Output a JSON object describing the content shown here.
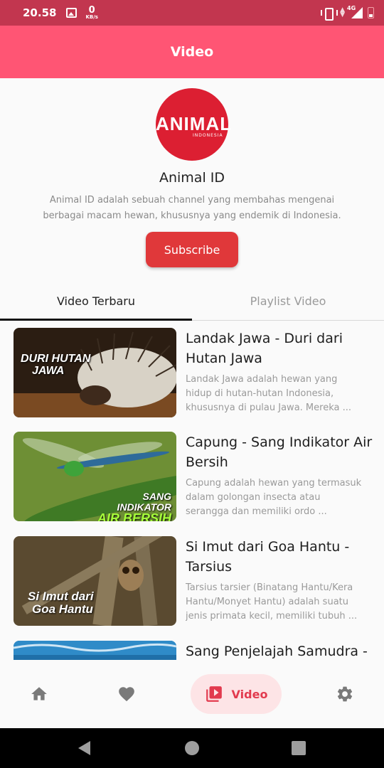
{
  "status_bar": {
    "time": "20.58",
    "speed_value": "0",
    "speed_unit": "KB/s",
    "network": "4G",
    "icons": [
      "gallery-icon",
      "vibrate-icon",
      "data-arrows-icon",
      "signal-icon",
      "battery-icon"
    ]
  },
  "app_bar": {
    "title": "Video"
  },
  "channel": {
    "logo_text": "ANIMAL",
    "logo_subtext": "INDONESIA",
    "name": "Animal ID",
    "description": "Animal ID adalah sebuah channel yang membahas mengenai berbagai macam hewan, khususnya yang endemik di Indonesia.",
    "subscribe_label": "Subscribe"
  },
  "tabs": [
    {
      "label": "Video Terbaru",
      "active": true
    },
    {
      "label": "Playlist Video",
      "active": false
    }
  ],
  "videos": [
    {
      "title": "Landak Jawa - Duri dari Hutan Jawa",
      "description": "Landak Jawa adalah hewan yang hidup di hutan-hutan Indonesia, khususnya di pulau Jawa. Mereka ...",
      "thumb_line1": "DURI HUTAN",
      "thumb_line2": "JAWA"
    },
    {
      "title": "Capung - Sang Indikator Air Bersih",
      "description": "Capung adalah hewan yang termasuk dalam golongan insecta atau serangga dan memiliki ordo ...",
      "thumb_line1": "SANG INDIKATOR",
      "thumb_line2": "AIR BERSIH"
    },
    {
      "title": "Si Imut dari Goa Hantu - Tarsius",
      "description": "Tarsius tarsier (Binatang Hantu/Kera Hantu/Monyet Hantu) adalah suatu jenis primata kecil, memiliki tubuh ...",
      "thumb_line1": "Si Imut dari",
      "thumb_line2": "Goa Hantu"
    },
    {
      "title": "Sang Penjelajah Samudra -",
      "description": "",
      "thumb_line1": "",
      "thumb_line2": ""
    }
  ],
  "bottom_nav": {
    "items": [
      {
        "icon": "home-icon",
        "active": false
      },
      {
        "icon": "heart-icon",
        "active": false
      },
      {
        "icon": "video-library-icon",
        "label": "Video",
        "active": true
      },
      {
        "icon": "gear-icon",
        "active": false
      }
    ]
  },
  "colors": {
    "status_bar": "#c2364f",
    "app_bar": "#ff5574",
    "subscribe": "#e0383a",
    "nav_active_bg": "#fde4e6",
    "nav_active_fg": "#e23a4e"
  }
}
